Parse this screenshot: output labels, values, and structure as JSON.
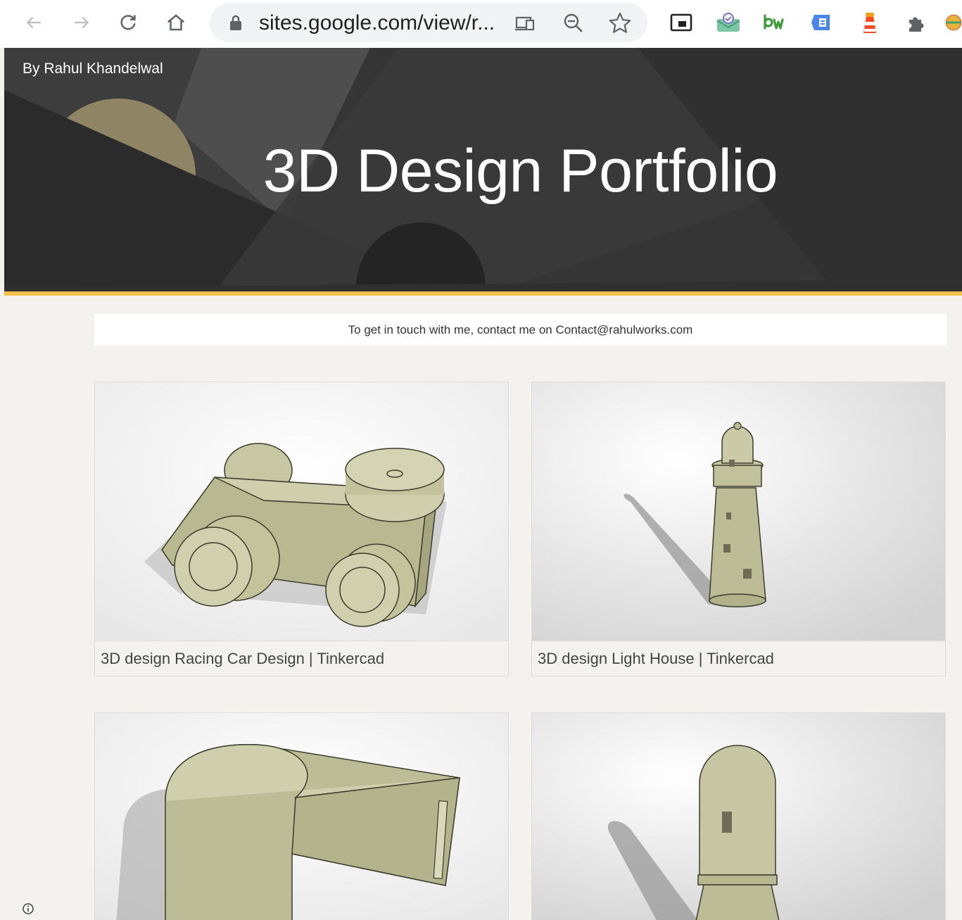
{
  "browser": {
    "url": "sites.google.com/view/r..."
  },
  "hero": {
    "author": "By Rahul Khandelwal",
    "title": "3D Design Portfolio"
  },
  "contact": {
    "text": "To get in touch with me, contact me on Contact@rahulworks.com"
  },
  "cards": [
    {
      "caption": "3D design Racing Car Design | Tinkercad"
    },
    {
      "caption": "3D design Light House | Tinkercad"
    },
    {
      "caption": ""
    },
    {
      "caption": ""
    }
  ],
  "colors": {
    "accent": "#f2c14e",
    "hero_bg": "#343434",
    "page_bg": "#f4f2ef",
    "model": "#b8b894"
  },
  "icons": [
    "back-icon",
    "forward-icon",
    "reload-icon",
    "home-icon",
    "lock-icon",
    "cast-icon",
    "zoom-out-icon",
    "star-icon",
    "picture-in-picture-icon",
    "extension-icon",
    "info-icon"
  ]
}
